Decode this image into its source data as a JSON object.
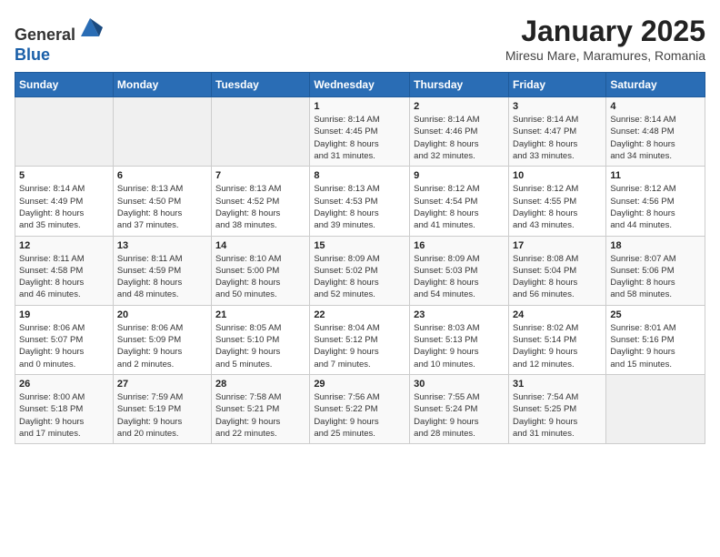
{
  "header": {
    "logo_line1": "General",
    "logo_line2": "Blue",
    "title": "January 2025",
    "subtitle": "Miresu Mare, Maramures, Romania"
  },
  "weekdays": [
    "Sunday",
    "Monday",
    "Tuesday",
    "Wednesday",
    "Thursday",
    "Friday",
    "Saturday"
  ],
  "weeks": [
    [
      {
        "day": "",
        "info": ""
      },
      {
        "day": "",
        "info": ""
      },
      {
        "day": "",
        "info": ""
      },
      {
        "day": "1",
        "info": "Sunrise: 8:14 AM\nSunset: 4:45 PM\nDaylight: 8 hours\nand 31 minutes."
      },
      {
        "day": "2",
        "info": "Sunrise: 8:14 AM\nSunset: 4:46 PM\nDaylight: 8 hours\nand 32 minutes."
      },
      {
        "day": "3",
        "info": "Sunrise: 8:14 AM\nSunset: 4:47 PM\nDaylight: 8 hours\nand 33 minutes."
      },
      {
        "day": "4",
        "info": "Sunrise: 8:14 AM\nSunset: 4:48 PM\nDaylight: 8 hours\nand 34 minutes."
      }
    ],
    [
      {
        "day": "5",
        "info": "Sunrise: 8:14 AM\nSunset: 4:49 PM\nDaylight: 8 hours\nand 35 minutes."
      },
      {
        "day": "6",
        "info": "Sunrise: 8:13 AM\nSunset: 4:50 PM\nDaylight: 8 hours\nand 37 minutes."
      },
      {
        "day": "7",
        "info": "Sunrise: 8:13 AM\nSunset: 4:52 PM\nDaylight: 8 hours\nand 38 minutes."
      },
      {
        "day": "8",
        "info": "Sunrise: 8:13 AM\nSunset: 4:53 PM\nDaylight: 8 hours\nand 39 minutes."
      },
      {
        "day": "9",
        "info": "Sunrise: 8:12 AM\nSunset: 4:54 PM\nDaylight: 8 hours\nand 41 minutes."
      },
      {
        "day": "10",
        "info": "Sunrise: 8:12 AM\nSunset: 4:55 PM\nDaylight: 8 hours\nand 43 minutes."
      },
      {
        "day": "11",
        "info": "Sunrise: 8:12 AM\nSunset: 4:56 PM\nDaylight: 8 hours\nand 44 minutes."
      }
    ],
    [
      {
        "day": "12",
        "info": "Sunrise: 8:11 AM\nSunset: 4:58 PM\nDaylight: 8 hours\nand 46 minutes."
      },
      {
        "day": "13",
        "info": "Sunrise: 8:11 AM\nSunset: 4:59 PM\nDaylight: 8 hours\nand 48 minutes."
      },
      {
        "day": "14",
        "info": "Sunrise: 8:10 AM\nSunset: 5:00 PM\nDaylight: 8 hours\nand 50 minutes."
      },
      {
        "day": "15",
        "info": "Sunrise: 8:09 AM\nSunset: 5:02 PM\nDaylight: 8 hours\nand 52 minutes."
      },
      {
        "day": "16",
        "info": "Sunrise: 8:09 AM\nSunset: 5:03 PM\nDaylight: 8 hours\nand 54 minutes."
      },
      {
        "day": "17",
        "info": "Sunrise: 8:08 AM\nSunset: 5:04 PM\nDaylight: 8 hours\nand 56 minutes."
      },
      {
        "day": "18",
        "info": "Sunrise: 8:07 AM\nSunset: 5:06 PM\nDaylight: 8 hours\nand 58 minutes."
      }
    ],
    [
      {
        "day": "19",
        "info": "Sunrise: 8:06 AM\nSunset: 5:07 PM\nDaylight: 9 hours\nand 0 minutes."
      },
      {
        "day": "20",
        "info": "Sunrise: 8:06 AM\nSunset: 5:09 PM\nDaylight: 9 hours\nand 2 minutes."
      },
      {
        "day": "21",
        "info": "Sunrise: 8:05 AM\nSunset: 5:10 PM\nDaylight: 9 hours\nand 5 minutes."
      },
      {
        "day": "22",
        "info": "Sunrise: 8:04 AM\nSunset: 5:12 PM\nDaylight: 9 hours\nand 7 minutes."
      },
      {
        "day": "23",
        "info": "Sunrise: 8:03 AM\nSunset: 5:13 PM\nDaylight: 9 hours\nand 10 minutes."
      },
      {
        "day": "24",
        "info": "Sunrise: 8:02 AM\nSunset: 5:14 PM\nDaylight: 9 hours\nand 12 minutes."
      },
      {
        "day": "25",
        "info": "Sunrise: 8:01 AM\nSunset: 5:16 PM\nDaylight: 9 hours\nand 15 minutes."
      }
    ],
    [
      {
        "day": "26",
        "info": "Sunrise: 8:00 AM\nSunset: 5:18 PM\nDaylight: 9 hours\nand 17 minutes."
      },
      {
        "day": "27",
        "info": "Sunrise: 7:59 AM\nSunset: 5:19 PM\nDaylight: 9 hours\nand 20 minutes."
      },
      {
        "day": "28",
        "info": "Sunrise: 7:58 AM\nSunset: 5:21 PM\nDaylight: 9 hours\nand 22 minutes."
      },
      {
        "day": "29",
        "info": "Sunrise: 7:56 AM\nSunset: 5:22 PM\nDaylight: 9 hours\nand 25 minutes."
      },
      {
        "day": "30",
        "info": "Sunrise: 7:55 AM\nSunset: 5:24 PM\nDaylight: 9 hours\nand 28 minutes."
      },
      {
        "day": "31",
        "info": "Sunrise: 7:54 AM\nSunset: 5:25 PM\nDaylight: 9 hours\nand 31 minutes."
      },
      {
        "day": "",
        "info": ""
      }
    ]
  ]
}
